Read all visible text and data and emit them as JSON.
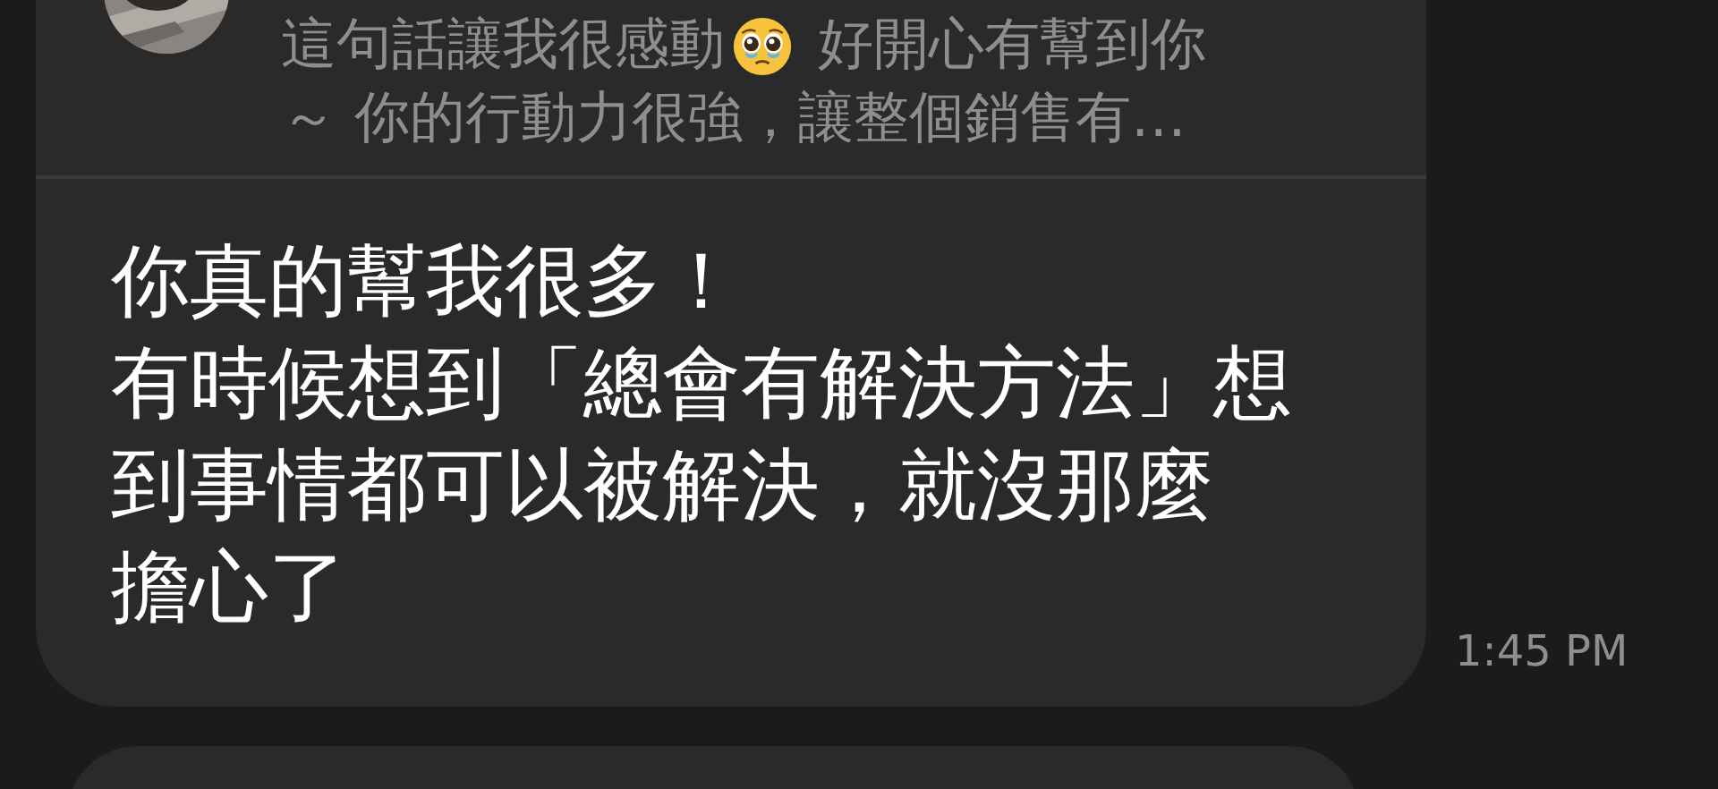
{
  "reply_quote": {
    "line_1_before_emoji": "這句話讓我很感動",
    "line_1_after_emoji": "好開心有幫到你",
    "line_2": "～ 你的行動力很強，讓整個銷售有…"
  },
  "message": {
    "lines": [
      "你真的幫我很多！",
      "有時候想到「總會有解決方法」想",
      "到事情都可以被解決，就沒那麼",
      "擔心了"
    ],
    "time": "1:45 PM"
  }
}
